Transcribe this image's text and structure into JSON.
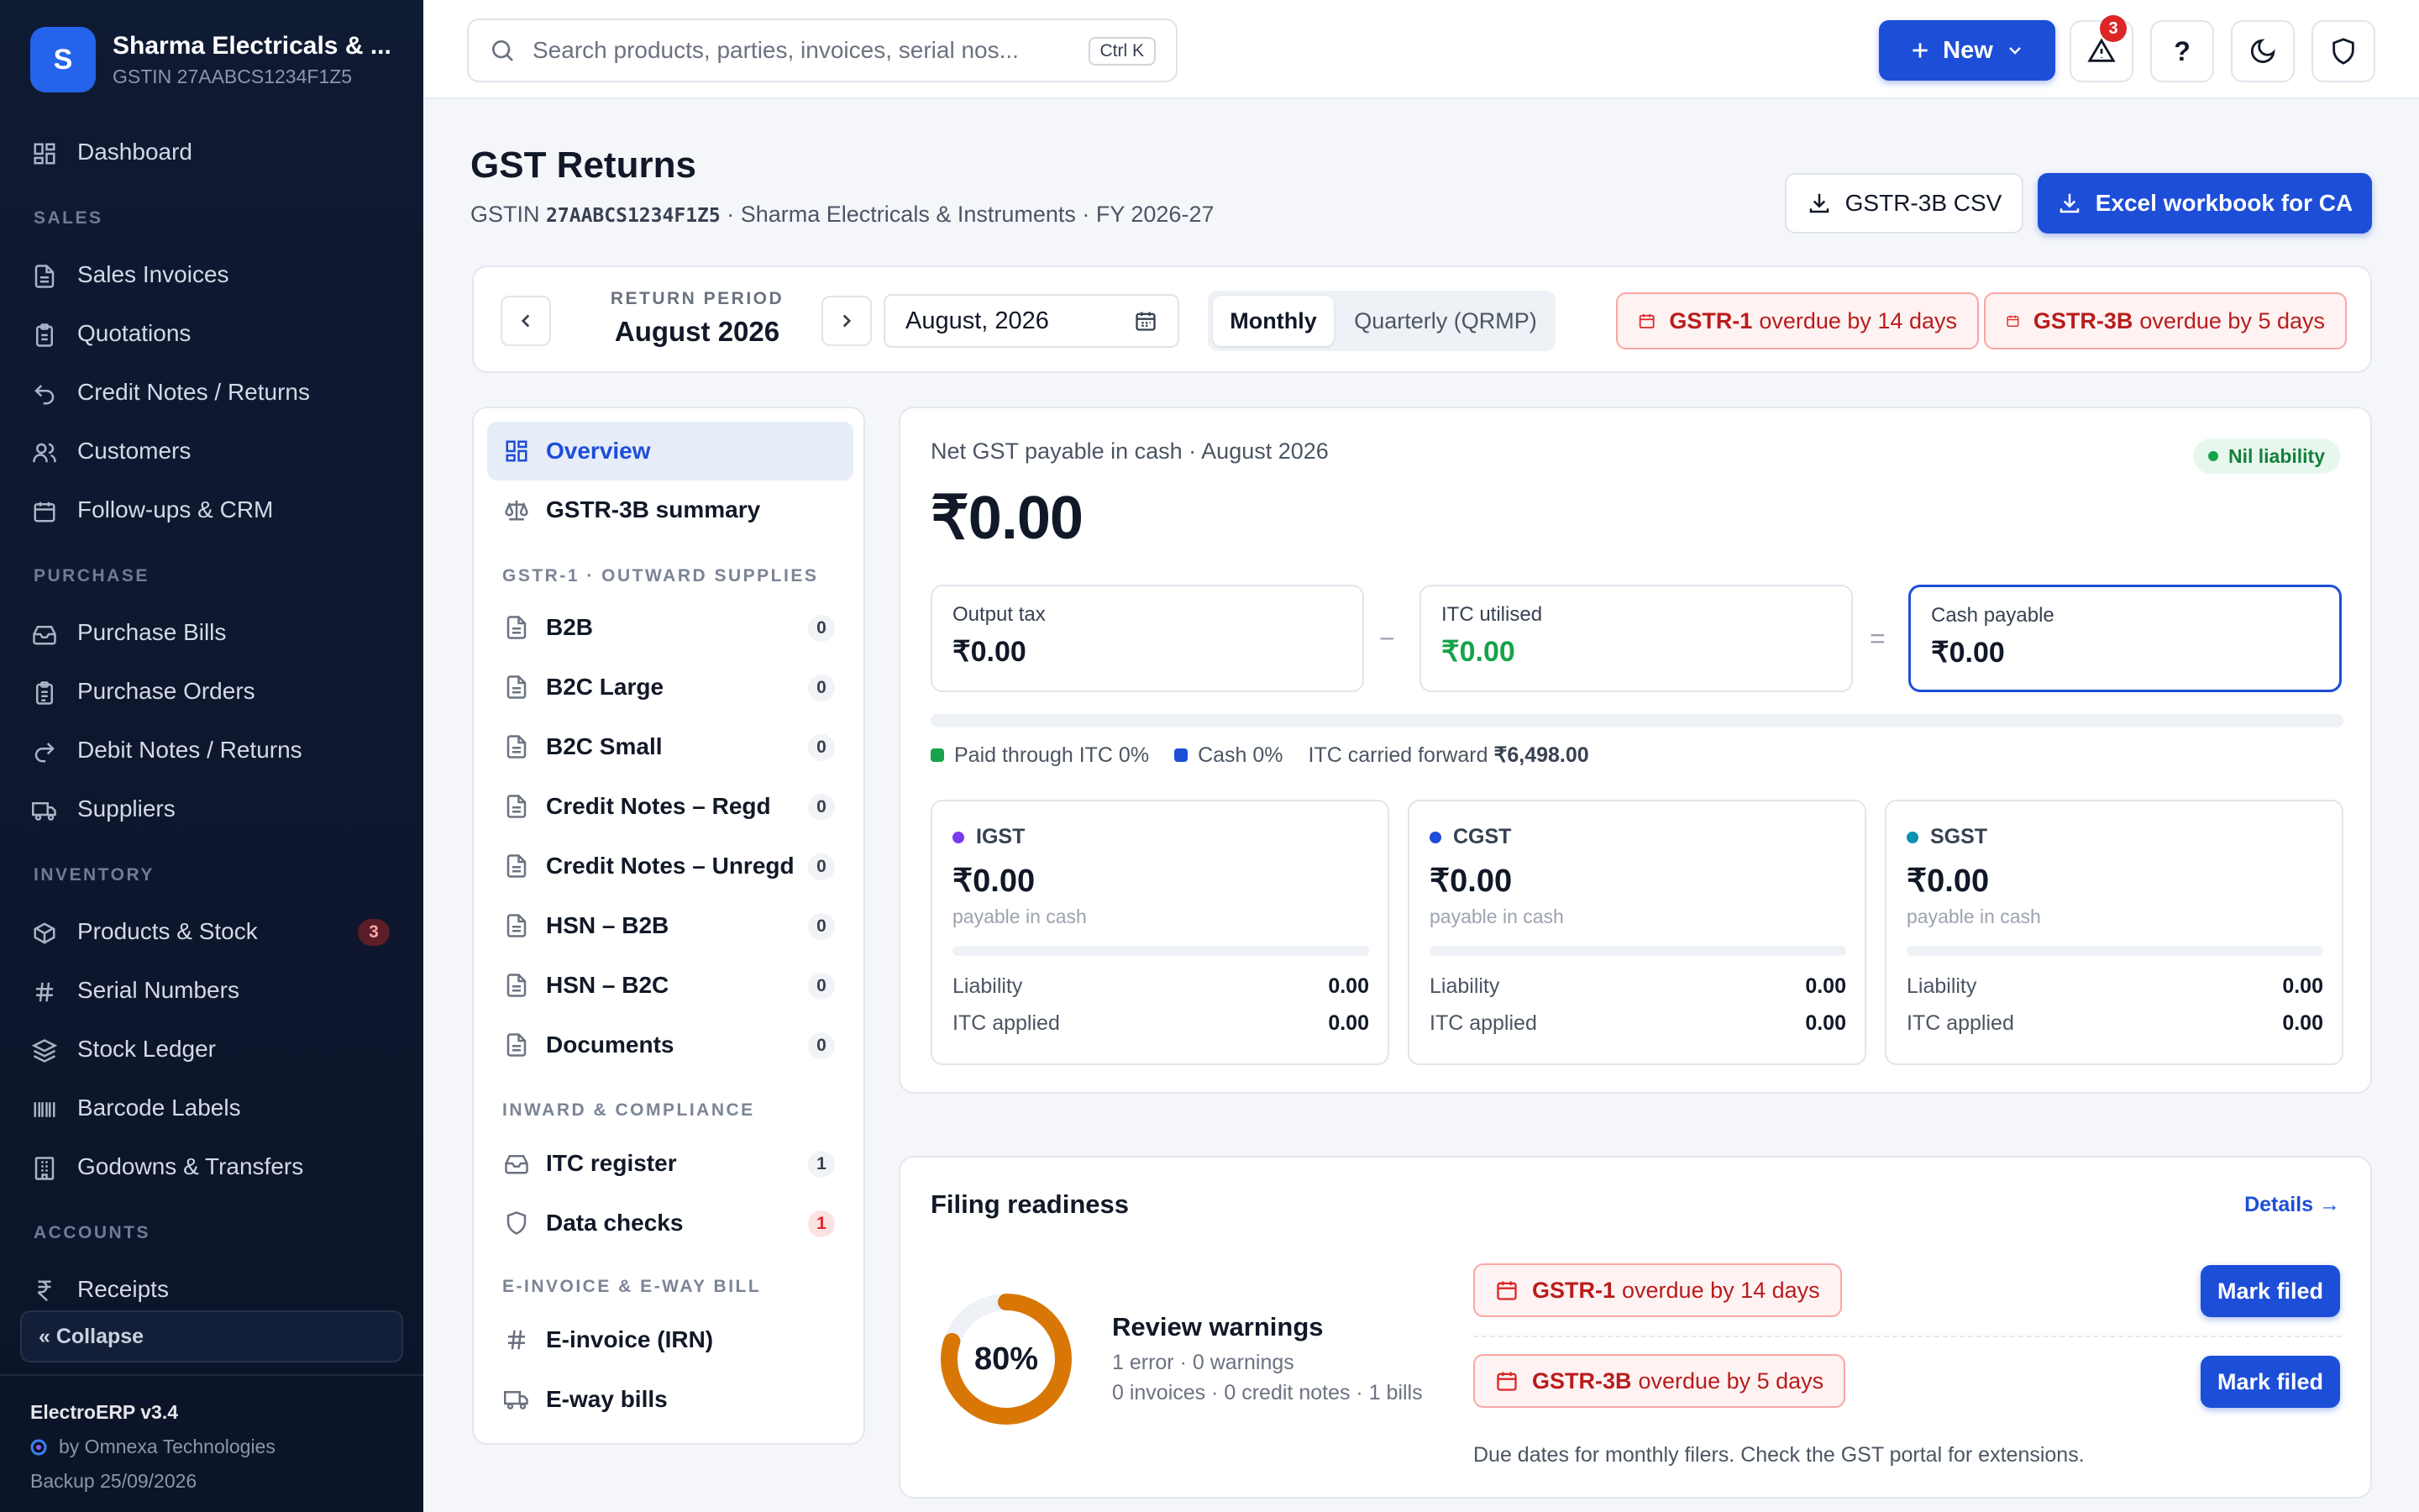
{
  "sidebar": {
    "logo_letter": "S",
    "company_name": "Sharma Electricals & ...",
    "company_gstin": "GSTIN 27AABCS1234F1Z5",
    "dashboard": "Dashboard",
    "sections": {
      "sales": "SALES",
      "purchase": "PURCHASE",
      "inventory": "INVENTORY",
      "accounts": "ACCOUNTS"
    },
    "items": {
      "sales_invoices": "Sales Invoices",
      "quotations": "Quotations",
      "credit_notes": "Credit Notes / Returns",
      "customers": "Customers",
      "followups": "Follow-ups & CRM",
      "purchase_bills": "Purchase Bills",
      "purchase_orders": "Purchase Orders",
      "debit_notes": "Debit Notes / Returns",
      "suppliers": "Suppliers",
      "products_stock": "Products & Stock",
      "products_stock_badge": "3",
      "serial_numbers": "Serial Numbers",
      "stock_ledger": "Stock Ledger",
      "barcode_labels": "Barcode Labels",
      "godowns": "Godowns & Transfers",
      "receipts": "Receipts"
    },
    "collapse": "« Collapse",
    "version": "ElectroERP v3.4",
    "by": "by Omnexa Technologies",
    "backup": "Backup 25/09/2026"
  },
  "topbar": {
    "search_placeholder": "Search products, parties, invoices, serial nos...",
    "shortcut": "Ctrl K",
    "new_label": "New",
    "alerts_count": "3",
    "help": "?"
  },
  "page": {
    "title": "GST Returns",
    "gstin_prefix": "GSTIN",
    "gstin": "27AABCS1234F1Z5",
    "subtitle_rest": " · Sharma Electricals & Instruments · FY 2026-27",
    "csv_button": "GSTR-3B CSV",
    "excel_button": "Excel workbook for CA"
  },
  "period": {
    "label": "RETURN PERIOD",
    "value": "August 2026",
    "month_input": "August, 2026",
    "seg_monthly": "Monthly",
    "seg_quarterly": "Quarterly (QRMP)",
    "due": [
      {
        "form": "GSTR-1",
        "text": "overdue by 14 days"
      },
      {
        "form": "GSTR-3B",
        "text": "overdue by 5 days"
      }
    ]
  },
  "subnav": {
    "overview": "Overview",
    "gstr3b_summary": "GSTR-3B summary",
    "gstr1_head": "GSTR-1 · OUTWARD SUPPLIES",
    "gstr1_items": [
      {
        "label": "B2B",
        "count": "0"
      },
      {
        "label": "B2C Large",
        "count": "0"
      },
      {
        "label": "B2C Small",
        "count": "0"
      },
      {
        "label": "Credit Notes – Regd",
        "count": "0"
      },
      {
        "label": "Credit Notes – Unregd",
        "count": "0"
      },
      {
        "label": "HSN – B2B",
        "count": "0"
      },
      {
        "label": "HSN – B2C",
        "count": "0"
      },
      {
        "label": "Documents",
        "count": "0"
      }
    ],
    "inward_head": "INWARD & COMPLIANCE",
    "itc_register": "ITC register",
    "itc_count": "1",
    "data_checks": "Data checks",
    "data_checks_count": "1",
    "einv_head": "E-INVOICE & E-WAY BILL",
    "einvoice": "E-invoice (IRN)",
    "eway": "E-way bills"
  },
  "summary": {
    "title": "Net GST payable in cash · August 2026",
    "badge": "Nil liability",
    "amount": "₹0.00",
    "output_tax_label": "Output tax",
    "output_tax": "₹0.00",
    "minus": "−",
    "itc_label": "ITC utilised",
    "itc": "₹0.00",
    "equals": "=",
    "cash_label": "Cash payable",
    "cash": "₹0.00",
    "paid_itc_pct": 0,
    "paid_cash_pct": 0,
    "legend_itc": "Paid through ITC 0%",
    "legend_cash": "Cash 0%",
    "itc_cf_label": "ITC carried forward",
    "itc_cf_value": "₹6,498.00",
    "taxes": [
      {
        "name": "IGST",
        "color": "#7c3aed",
        "amount": "₹0.00",
        "sub": "payable in cash",
        "liability_label": "Liability",
        "liability": "0.00",
        "itc_label": "ITC applied",
        "itc": "0.00"
      },
      {
        "name": "CGST",
        "color": "#1d4ed8",
        "amount": "₹0.00",
        "sub": "payable in cash",
        "liability_label": "Liability",
        "liability": "0.00",
        "itc_label": "ITC applied",
        "itc": "0.00"
      },
      {
        "name": "SGST",
        "color": "#0891b2",
        "amount": "₹0.00",
        "sub": "payable in cash",
        "liability_label": "Liability",
        "liability": "0.00",
        "itc_label": "ITC applied",
        "itc": "0.00"
      }
    ]
  },
  "readiness": {
    "title": "Filing readiness",
    "details": "Details →",
    "percent_value": 80,
    "percent": "80%",
    "color": "#d97706",
    "heading": "Review warnings",
    "line1": "1 error · 0 warnings",
    "line2": "0 invoices · 0 credit notes · 1 bills",
    "due": [
      {
        "form": "GSTR-1",
        "text": "overdue by 14 days",
        "button": "Mark filed"
      },
      {
        "form": "GSTR-3B",
        "text": "overdue by 5 days",
        "button": "Mark filed"
      }
    ],
    "note": "Due dates for monthly filers. Check the GST portal for extensions."
  }
}
